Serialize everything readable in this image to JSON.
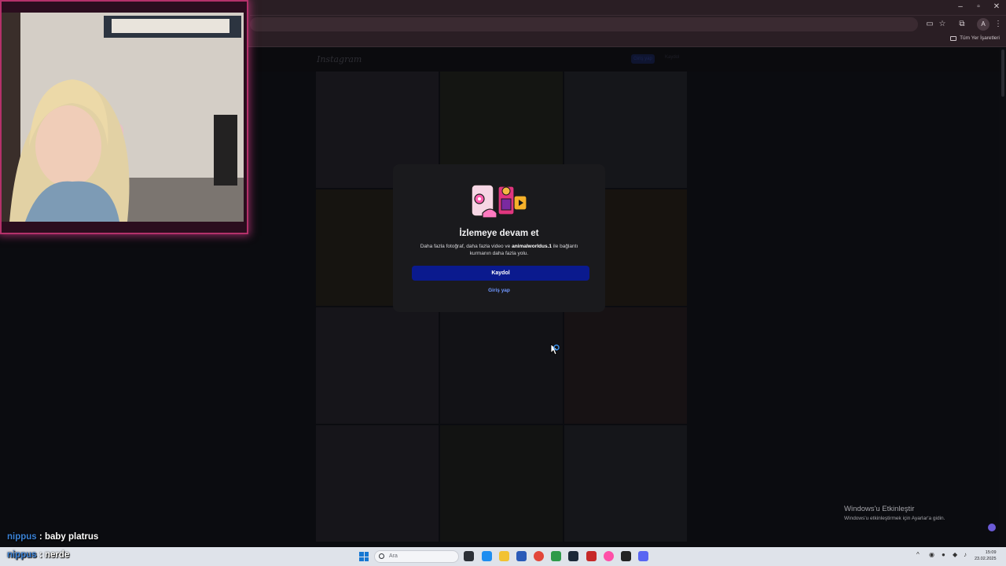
{
  "browser": {
    "bookmarks_all_label": "Tüm Yer İşaretleri",
    "profile_initial": "A"
  },
  "page": {
    "logo_text": "Instagram",
    "header_login": "Giriş yap",
    "header_signup": "Kaydol"
  },
  "modal": {
    "title": "İzlemeye devam et",
    "text_before": "Daha fazla fotoğraf, daha fazla video ve ",
    "username": "animalworldus.1",
    "text_after": " ile bağlantı kurmanın daha fazla yolu.",
    "signup_label": "Kaydol",
    "login_label": "Giriş yap",
    "accent_color": "#0a1a8e",
    "link_color": "#6f97ff"
  },
  "watermark": {
    "title": "Windows'u Etkinleştir",
    "subtitle": "Windows'u etkinleştirmek için Ayarlar'a gidin."
  },
  "chat": [
    {
      "user": "nippus",
      "separator": " : ",
      "message": "baby platrus"
    },
    {
      "user": "nippus",
      "separator": " : ",
      "message": "nerde"
    }
  ],
  "taskbar": {
    "search_placeholder": "Ara",
    "time": "15:09",
    "date": "23.02.2025"
  }
}
